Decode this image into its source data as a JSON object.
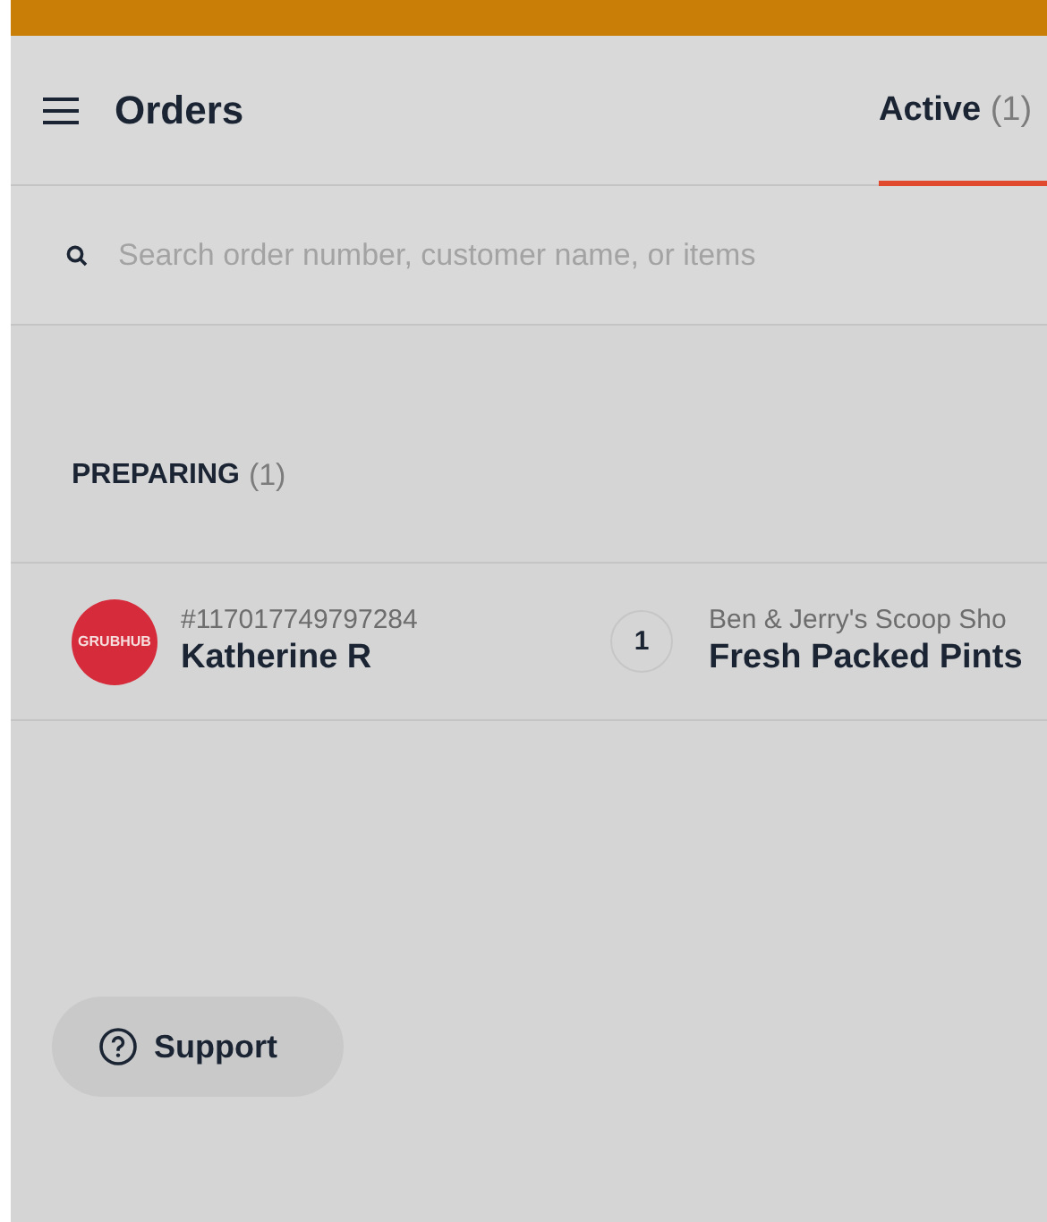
{
  "header": {
    "title": "Orders",
    "tabs": [
      {
        "label": "Active",
        "count": "(1)",
        "selected": true
      }
    ]
  },
  "search": {
    "placeholder": "Search order number, customer name, or items"
  },
  "sections": [
    {
      "title": "PREPARING",
      "count": "(1)",
      "orders": [
        {
          "logo": "GRUBHUB",
          "number": "#117017749797284",
          "customer": "Katherine R",
          "quantity": "1",
          "store": "Ben & Jerry's Scoop Sho",
          "item": "Fresh Packed Pints"
        }
      ]
    }
  ],
  "support_button": "Support"
}
